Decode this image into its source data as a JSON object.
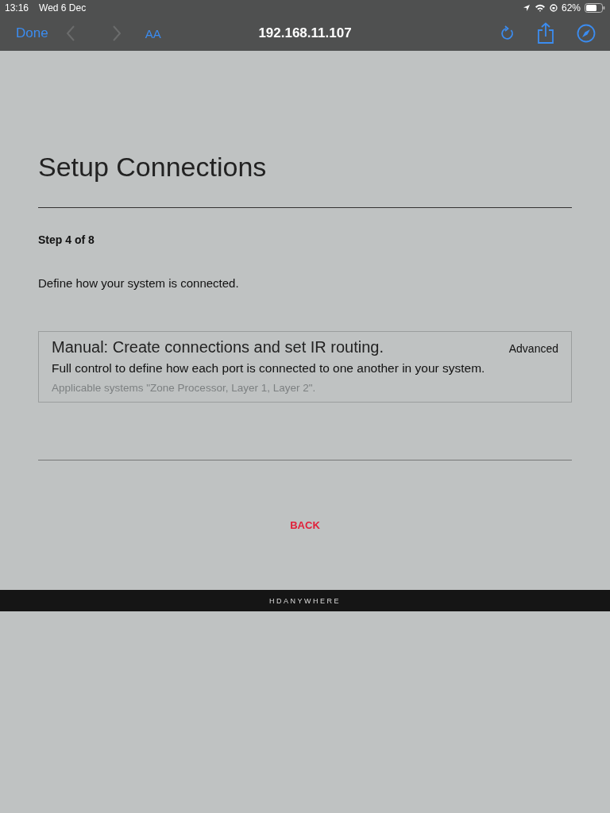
{
  "status_bar": {
    "time": "13:16",
    "date": "Wed 6 Dec",
    "battery": "62%"
  },
  "browser_toolbar": {
    "done": "Done",
    "back_disabled": true,
    "forward_disabled": true,
    "text_size": "AA",
    "address": "192.168.11.107"
  },
  "page": {
    "title": "Setup Connections",
    "step": "Step 4 of 8",
    "instruction": "Define how your system is connected.",
    "options": [
      {
        "title": "Manual: Create connections and set IR routing.",
        "tag": "Advanced",
        "description": "Full control to define how each port is connected to one another in your system.",
        "note": "Applicable systems \"Zone Processor, Layer 1, Layer 2\"."
      }
    ],
    "back_button": "BACK"
  },
  "footer": {
    "brand": "HDANYWHERE"
  }
}
